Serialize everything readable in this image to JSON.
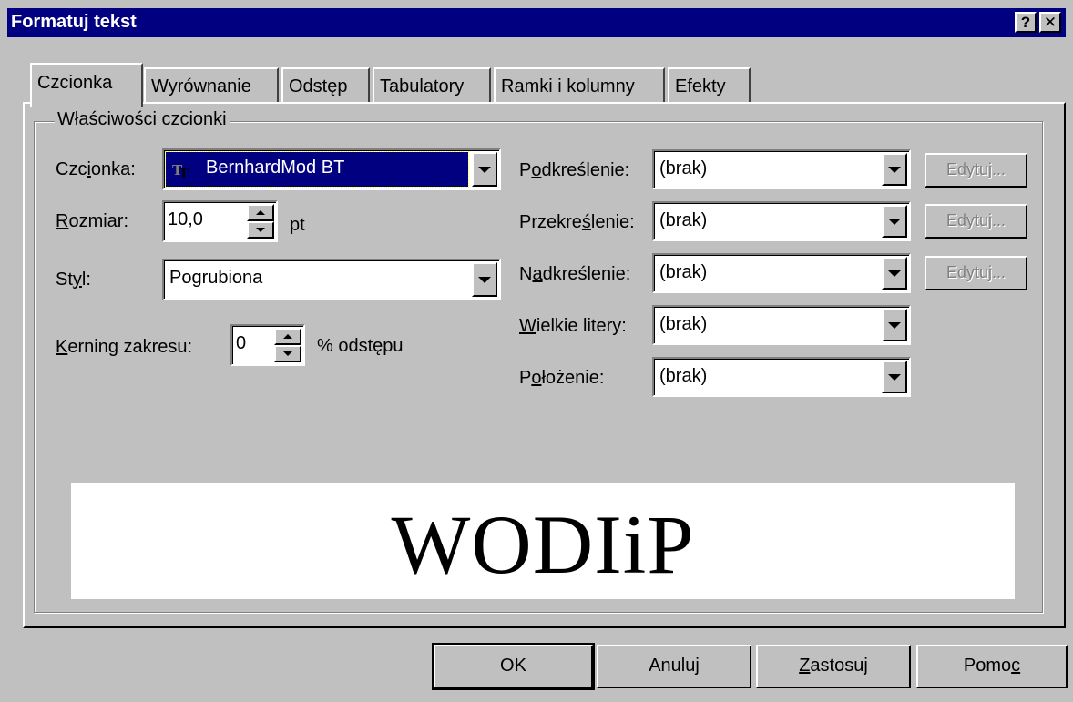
{
  "window": {
    "title": "Formatuj tekst"
  },
  "titlebar_buttons": {
    "help": "?",
    "close": "✕"
  },
  "tabs": [
    {
      "label": "Czcionka",
      "active": true
    },
    {
      "label": "Wyrównanie"
    },
    {
      "label": "Odstęp"
    },
    {
      "label": "Tabulatory"
    },
    {
      "label": "Ramki i kolumny"
    },
    {
      "label": "Efekty"
    }
  ],
  "group": {
    "legend": "Właściwości czcionki"
  },
  "font": {
    "label_pre": "Czc",
    "label_u": "i",
    "label_post": "onka:",
    "value": "BernhardMod BT",
    "icon": "truetype-font-icon"
  },
  "size": {
    "label_u": "R",
    "label_post": "ozmiar:",
    "value": "10,0",
    "unit": "pt"
  },
  "style": {
    "label_pre": "St",
    "label_u": "y",
    "label_post": "l:",
    "value": "Pogrubiona"
  },
  "kerning": {
    "label_u": "K",
    "label_post": "erning zakresu:",
    "value": "0",
    "unit": "% odstępu"
  },
  "underline": {
    "label_pre": "P",
    "label_u": "o",
    "label_post": "dkreślenie:",
    "value": "(brak)",
    "edit": "Edytuj..."
  },
  "strikeout": {
    "label_pre": "Przekre",
    "label_u": "ś",
    "label_post": "lenie:",
    "value": "(brak)",
    "edit": "Edytuj..."
  },
  "overline": {
    "label_pre": "N",
    "label_u": "a",
    "label_post": "dkreślenie:",
    "value": "(brak)",
    "edit": "Edytuj..."
  },
  "caps": {
    "label_u": "W",
    "label_post": "ielkie litery:",
    "value": "(brak)"
  },
  "position": {
    "label_pre": "P",
    "label_u": "o",
    "label_post": "łożenie:",
    "value": "(brak)"
  },
  "preview": {
    "text": "WODIiP"
  },
  "buttons": {
    "ok": "OK",
    "cancel": "Anuluj",
    "apply_u": "Z",
    "apply_post": "astosuj",
    "help_pre": "Pomo",
    "help_u": "c"
  },
  "colors": {
    "titlebar": "#000080",
    "face": "#c0c0c0",
    "selection": "#000080"
  }
}
